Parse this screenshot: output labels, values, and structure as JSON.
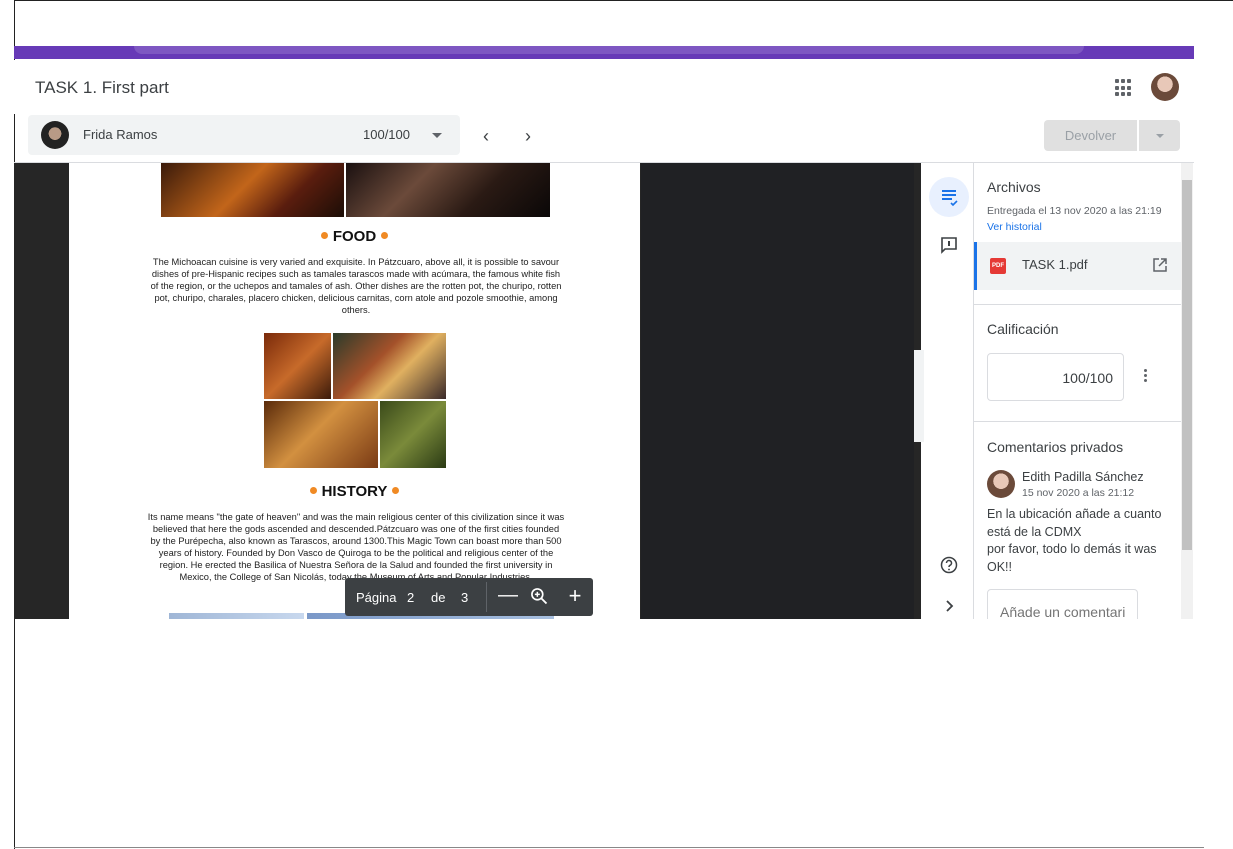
{
  "header": {
    "title": "TASK 1. First part"
  },
  "student": {
    "name": "Frida Ramos",
    "grade": "100/100"
  },
  "toolbar": {
    "return_label": "Devolver"
  },
  "document": {
    "food_title": "FOOD",
    "food_text": "The Michoacan cuisine is very varied and exquisite. In Pátzcuaro, above all, it is possible to savour dishes of pre-Hispanic recipes such as tamales tarascos made with acúmara, the famous white fish of the region, or the uchepos and tamales of ash. Other dishes are the rotten pot, the churipo, rotten pot, churipo, charales, placero chicken, delicious carnitas, corn atole and pozole smoothie, among others.",
    "history_title": "HISTORY",
    "history_text": "Its name means \"the gate of heaven\" and was the main religious center of this civilization since it was believed that here the gods ascended and descended.Pátzcuaro was one of the first cities founded by the Purépecha, also known as Tarascos, around 1300.This Magic Town can boast more than 500 years of history. Founded by Don Vasco de Quiroga to be the political and religious center of the region. He erected the Basilica of Nuestra Señora de la Salud and founded the first university in Mexico, the College of San Nicolás, today the Museum of Arts and Popular Industries."
  },
  "page_controls": {
    "label": "Página",
    "current": "2",
    "of_label": "de",
    "total": "3"
  },
  "panel": {
    "files_heading": "Archivos",
    "submitted": "Entregada el 13 nov 2020 a las 21:19",
    "history_link": "Ver historial",
    "file_name": "TASK 1.pdf",
    "file_badge": "PDF",
    "grade_heading": "Calificación",
    "grade_value": "100/100",
    "comments_heading": "Comentarios privados",
    "comment_author": "Edith Padilla Sánchez",
    "comment_date": "15 nov 2020 a las 21:12",
    "comment_text": "En la ubicación añade a cuanto está de la CDMX\npor favor, todo lo demás it was OK!!",
    "comment_placeholder": "Añade un comentario ..."
  },
  "colors": {
    "brand": "#673ab7",
    "accent": "#1a73e8",
    "section_dot": "#f08a24"
  },
  "icons": [
    "apps-grid-icon",
    "chevron-left-icon",
    "chevron-right-icon",
    "rubric-icon",
    "comment-icon",
    "help-icon",
    "expand-icon",
    "open-in-new-icon",
    "zoom-in-icon",
    "more-vert-icon"
  ]
}
